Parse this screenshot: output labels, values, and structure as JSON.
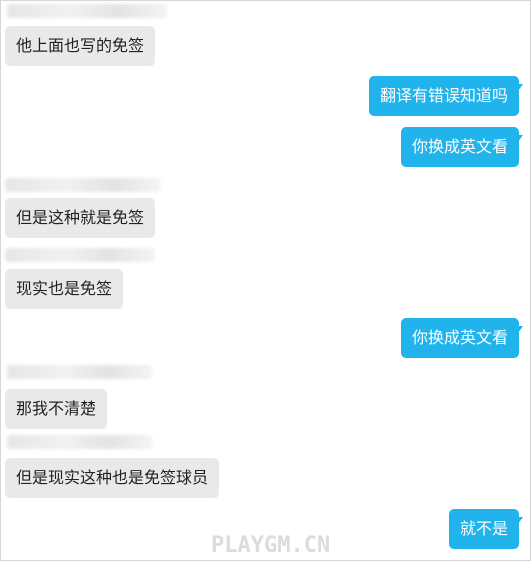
{
  "messages": [
    {
      "side": "in",
      "text": "他上面也写的免签"
    },
    {
      "side": "out",
      "text": "翻译有错误知道吗"
    },
    {
      "side": "out",
      "text": "你换成英文看"
    },
    {
      "side": "in",
      "text": "但是这种就是免签"
    },
    {
      "side": "in",
      "text": "现实也是免签"
    },
    {
      "side": "out",
      "text": "你换成英文看"
    },
    {
      "side": "in",
      "text": "那我不清楚"
    },
    {
      "side": "in",
      "text": "但是现实这种也是免签球员"
    },
    {
      "side": "out",
      "text": "就不是"
    }
  ],
  "watermark": "PLAYGM.CN",
  "colors": {
    "outgoing_bubble": "#20b3ec",
    "incoming_bubble": "#e9e9e9"
  }
}
